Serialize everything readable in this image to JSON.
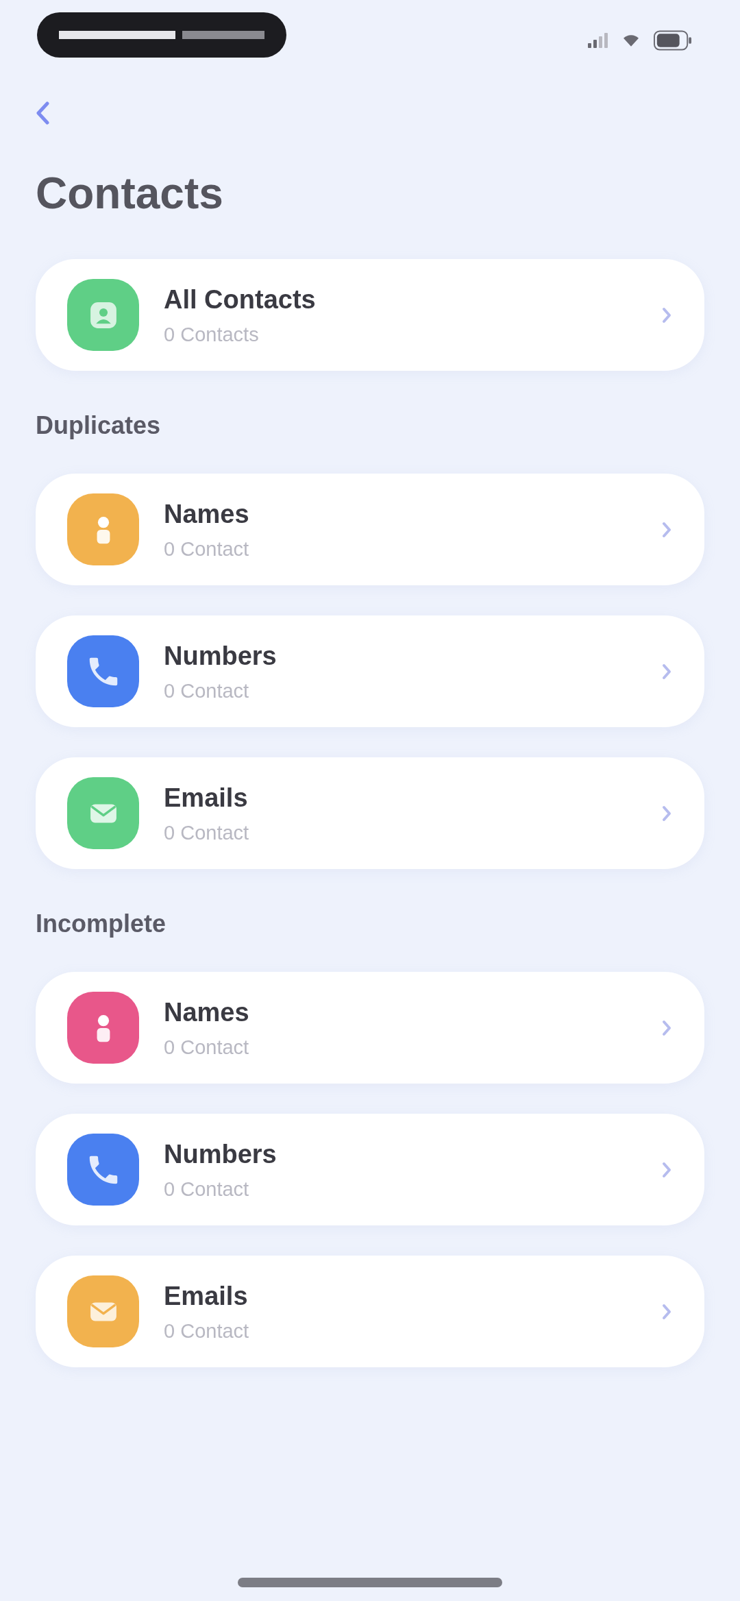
{
  "header": {
    "title": "Contacts"
  },
  "groups": [
    {
      "items": [
        {
          "kind": "contacts",
          "title": "All Contacts",
          "subtitle": "0 Contacts",
          "color": "#5fcf86"
        }
      ]
    },
    {
      "heading": "Duplicates",
      "items": [
        {
          "kind": "name",
          "title": "Names",
          "subtitle": "0 Contact",
          "color": "#f2b24e"
        },
        {
          "kind": "number",
          "title": "Numbers",
          "subtitle": "0 Contact",
          "color": "#4a80f0"
        },
        {
          "kind": "email",
          "title": "Emails",
          "subtitle": "0 Contact",
          "color": "#5fcf86"
        }
      ]
    },
    {
      "heading": "Incomplete",
      "items": [
        {
          "kind": "name",
          "title": "Names",
          "subtitle": "0 Contact",
          "color": "#e8578a"
        },
        {
          "kind": "number",
          "title": "Numbers",
          "subtitle": "0 Contact",
          "color": "#4a80f0"
        },
        {
          "kind": "email",
          "title": "Emails",
          "subtitle": "0 Contact",
          "color": "#f2b24e"
        }
      ]
    }
  ]
}
